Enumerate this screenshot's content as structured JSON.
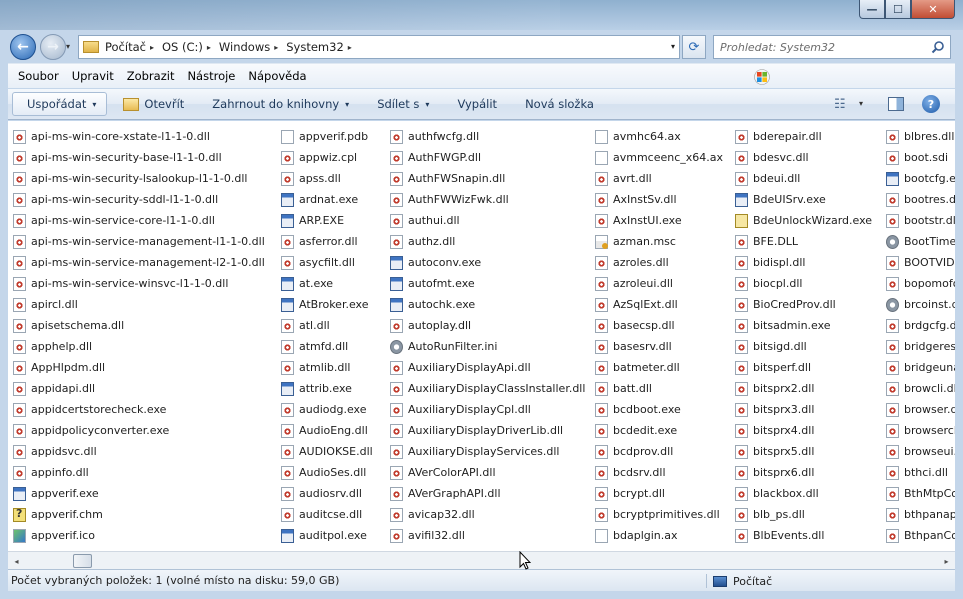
{
  "window": {
    "controls": {
      "minimize": "—",
      "maximize": "☐",
      "close": "✕"
    }
  },
  "nav": {
    "back": "←",
    "forward": "→",
    "history_dropdown": "▾"
  },
  "address": {
    "crumbs": [
      "Počítač",
      "OS (C:)",
      "Windows",
      "System32"
    ],
    "separator": "▸",
    "dropdown": "▾",
    "refresh": "⟳"
  },
  "search": {
    "placeholder": "Prohledat: System32"
  },
  "menu": [
    "Soubor",
    "Upravit",
    "Zobrazit",
    "Nástroje",
    "Nápověda"
  ],
  "commands": {
    "organize": "Uspořádat",
    "open": "Otevřít",
    "include": "Zahrnout do knihovny",
    "share": "Sdílet s",
    "burn": "Vypálit",
    "new_folder": "Nová složka",
    "dropdown": "▾",
    "views": "☷",
    "help": "?"
  },
  "columns": [
    [
      {
        "name": "api-ms-win-core-xstate-l1-1-0.dll",
        "icon": "dll"
      },
      {
        "name": "api-ms-win-security-base-l1-1-0.dll",
        "icon": "dll"
      },
      {
        "name": "api-ms-win-security-lsalookup-l1-1-0.dll",
        "icon": "dll"
      },
      {
        "name": "api-ms-win-security-sddl-l1-1-0.dll",
        "icon": "dll"
      },
      {
        "name": "api-ms-win-service-core-l1-1-0.dll",
        "icon": "dll"
      },
      {
        "name": "api-ms-win-service-management-l1-1-0.dll",
        "icon": "dll"
      },
      {
        "name": "api-ms-win-service-management-l2-1-0.dll",
        "icon": "dll"
      },
      {
        "name": "api-ms-win-service-winsvc-l1-1-0.dll",
        "icon": "dll"
      },
      {
        "name": "apircl.dll",
        "icon": "dll"
      },
      {
        "name": "apisetschema.dll",
        "icon": "dll"
      },
      {
        "name": "apphelp.dll",
        "icon": "dll"
      },
      {
        "name": "AppHlpdm.dll",
        "icon": "dll"
      },
      {
        "name": "appidapi.dll",
        "icon": "dll"
      },
      {
        "name": "appidcertstorecheck.exe",
        "icon": "dll"
      },
      {
        "name": "appidpolicyconverter.exe",
        "icon": "dll"
      },
      {
        "name": "appidsvc.dll",
        "icon": "dll"
      },
      {
        "name": "appinfo.dll",
        "icon": "dll"
      },
      {
        "name": "appverif.exe",
        "icon": "exe"
      },
      {
        "name": "appverif.chm",
        "icon": "chm"
      },
      {
        "name": "appverif.ico",
        "icon": "ico"
      }
    ],
    [
      {
        "name": "appverif.pdb",
        "icon": "doc"
      },
      {
        "name": "appwiz.cpl",
        "icon": "dll"
      },
      {
        "name": "apss.dll",
        "icon": "dll"
      },
      {
        "name": "ardnat.exe",
        "icon": "exe"
      },
      {
        "name": "ARP.EXE",
        "icon": "exe"
      },
      {
        "name": "asferror.dll",
        "icon": "dll"
      },
      {
        "name": "asycfilt.dll",
        "icon": "dll"
      },
      {
        "name": "at.exe",
        "icon": "exe"
      },
      {
        "name": "AtBroker.exe",
        "icon": "exe"
      },
      {
        "name": "atl.dll",
        "icon": "dll"
      },
      {
        "name": "atmfd.dll",
        "icon": "dll"
      },
      {
        "name": "atmlib.dll",
        "icon": "dll"
      },
      {
        "name": "attrib.exe",
        "icon": "exe"
      },
      {
        "name": "audiodg.exe",
        "icon": "dll"
      },
      {
        "name": "AudioEng.dll",
        "icon": "dll"
      },
      {
        "name": "AUDIOKSE.dll",
        "icon": "dll"
      },
      {
        "name": "AudioSes.dll",
        "icon": "dll"
      },
      {
        "name": "audiosrv.dll",
        "icon": "dll"
      },
      {
        "name": "auditcse.dll",
        "icon": "dll"
      },
      {
        "name": "auditpol.exe",
        "icon": "exe"
      }
    ],
    [
      {
        "name": "authfwcfg.dll",
        "icon": "dll"
      },
      {
        "name": "AuthFWGP.dll",
        "icon": "dll"
      },
      {
        "name": "AuthFWSnapin.dll",
        "icon": "dll"
      },
      {
        "name": "AuthFWWizFwk.dll",
        "icon": "dll"
      },
      {
        "name": "authui.dll",
        "icon": "dll"
      },
      {
        "name": "authz.dll",
        "icon": "dll"
      },
      {
        "name": "autoconv.exe",
        "icon": "exe"
      },
      {
        "name": "autofmt.exe",
        "icon": "exe"
      },
      {
        "name": "autochk.exe",
        "icon": "exe"
      },
      {
        "name": "autoplay.dll",
        "icon": "dll"
      },
      {
        "name": "AutoRunFilter.ini",
        "icon": "gear"
      },
      {
        "name": "AuxiliaryDisplayApi.dll",
        "icon": "dll"
      },
      {
        "name": "AuxiliaryDisplayClassInstaller.dll",
        "icon": "dll"
      },
      {
        "name": "AuxiliaryDisplayCpl.dll",
        "icon": "dll"
      },
      {
        "name": "AuxiliaryDisplayDriverLib.dll",
        "icon": "dll"
      },
      {
        "name": "AuxiliaryDisplayServices.dll",
        "icon": "dll"
      },
      {
        "name": "AVerColorAPI.dll",
        "icon": "dll"
      },
      {
        "name": "AVerGraphAPI.dll",
        "icon": "dll"
      },
      {
        "name": "avicap32.dll",
        "icon": "dll"
      },
      {
        "name": "avifil32.dll",
        "icon": "dll"
      }
    ],
    [
      {
        "name": "avmhc64.ax",
        "icon": "doc"
      },
      {
        "name": "avmmceenc_x64.ax",
        "icon": "doc"
      },
      {
        "name": "avrt.dll",
        "icon": "dll"
      },
      {
        "name": "AxInstSv.dll",
        "icon": "dll"
      },
      {
        "name": "AxInstUI.exe",
        "icon": "dll"
      },
      {
        "name": "azman.msc",
        "icon": "msc"
      },
      {
        "name": "azroles.dll",
        "icon": "dll"
      },
      {
        "name": "azroleui.dll",
        "icon": "dll"
      },
      {
        "name": "AzSqlExt.dll",
        "icon": "dll"
      },
      {
        "name": "basecsp.dll",
        "icon": "dll"
      },
      {
        "name": "basesrv.dll",
        "icon": "dll"
      },
      {
        "name": "batmeter.dll",
        "icon": "dll"
      },
      {
        "name": "batt.dll",
        "icon": "dll"
      },
      {
        "name": "bcdboot.exe",
        "icon": "dll"
      },
      {
        "name": "bcdedit.exe",
        "icon": "dll"
      },
      {
        "name": "bcdprov.dll",
        "icon": "dll"
      },
      {
        "name": "bcdsrv.dll",
        "icon": "dll"
      },
      {
        "name": "bcrypt.dll",
        "icon": "dll"
      },
      {
        "name": "bcryptprimitives.dll",
        "icon": "dll"
      },
      {
        "name": "bdaplgin.ax",
        "icon": "doc"
      }
    ],
    [
      {
        "name": "bderepair.dll",
        "icon": "dll"
      },
      {
        "name": "bdesvc.dll",
        "icon": "dll"
      },
      {
        "name": "bdeui.dll",
        "icon": "dll"
      },
      {
        "name": "BdeUISrv.exe",
        "icon": "exe"
      },
      {
        "name": "BdeUnlockWizard.exe",
        "icon": "key"
      },
      {
        "name": "BFE.DLL",
        "icon": "dll"
      },
      {
        "name": "bidispl.dll",
        "icon": "dll"
      },
      {
        "name": "biocpl.dll",
        "icon": "dll"
      },
      {
        "name": "BioCredProv.dll",
        "icon": "dll"
      },
      {
        "name": "bitsadmin.exe",
        "icon": "dll"
      },
      {
        "name": "bitsigd.dll",
        "icon": "dll"
      },
      {
        "name": "bitsperf.dll",
        "icon": "dll"
      },
      {
        "name": "bitsprx2.dll",
        "icon": "dll"
      },
      {
        "name": "bitsprx3.dll",
        "icon": "dll"
      },
      {
        "name": "bitsprx4.dll",
        "icon": "dll"
      },
      {
        "name": "bitsprx5.dll",
        "icon": "dll"
      },
      {
        "name": "bitsprx6.dll",
        "icon": "dll"
      },
      {
        "name": "blackbox.dll",
        "icon": "dll"
      },
      {
        "name": "blb_ps.dll",
        "icon": "dll"
      },
      {
        "name": "BlbEvents.dll",
        "icon": "dll"
      }
    ],
    [
      {
        "name": "blbres.dll",
        "icon": "dll"
      },
      {
        "name": "boot.sdi",
        "icon": "dll"
      },
      {
        "name": "bootcfg.exe",
        "icon": "exe"
      },
      {
        "name": "bootres.dll",
        "icon": "dll"
      },
      {
        "name": "bootstr.dll",
        "icon": "dll"
      },
      {
        "name": "BootTime",
        "icon": "gear"
      },
      {
        "name": "BOOTVID",
        "icon": "dll"
      },
      {
        "name": "bopomofo",
        "icon": "dll"
      },
      {
        "name": "brcoinst.d",
        "icon": "gear"
      },
      {
        "name": "brdgcfg.d",
        "icon": "dll"
      },
      {
        "name": "bridgeres.",
        "icon": "dll"
      },
      {
        "name": "bridgeunat",
        "icon": "dll"
      },
      {
        "name": "browcli.dl",
        "icon": "dll"
      },
      {
        "name": "browser.dl",
        "icon": "dll"
      },
      {
        "name": "browserch",
        "icon": "dll"
      },
      {
        "name": "browseui.",
        "icon": "dll"
      },
      {
        "name": "bthci.dll",
        "icon": "dll"
      },
      {
        "name": "BthMtpCo",
        "icon": "dll"
      },
      {
        "name": "bthpanap",
        "icon": "dll"
      },
      {
        "name": "BthpanCo",
        "icon": "dll"
      }
    ]
  ],
  "scrollbar": {
    "left": "◂",
    "right": "▸"
  },
  "status": {
    "text": "Počet vybraných položek: 1 (volné místo na disku: 59,0 GB)",
    "location": "Počítač"
  }
}
